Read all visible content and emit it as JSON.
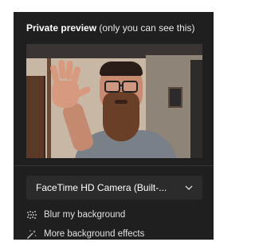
{
  "panel": {
    "title_bold": "Private preview",
    "title_rest": " (only you can see this)"
  },
  "camera": {
    "selected": "FaceTime HD Camera (Built-..."
  },
  "options": [
    {
      "label": "Blur my background",
      "icon": "blur-icon"
    },
    {
      "label": "More background effects",
      "icon": "magic-wand-icon"
    }
  ],
  "colors": {
    "panel_bg": "#1f1f1f",
    "select_bg": "#2b2b2b",
    "text": "#ffffff"
  }
}
